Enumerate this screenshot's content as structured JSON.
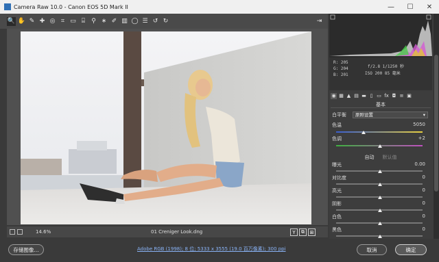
{
  "window": {
    "title": "Camera Raw 10.0 - Canon EOS 5D Mark II",
    "minimize": "—",
    "maximize": "☐",
    "close": "✕"
  },
  "toolbar": {
    "tools": [
      {
        "icon": "zoom-icon",
        "glyph": "🔍",
        "active": true
      },
      {
        "icon": "hand-icon",
        "glyph": "✋"
      },
      {
        "icon": "white-balance-icon",
        "glyph": "✎"
      },
      {
        "icon": "color-sampler-icon",
        "glyph": "✚"
      },
      {
        "icon": "targeted-adjust-icon",
        "glyph": "◎"
      },
      {
        "icon": "crop-icon",
        "glyph": "⌗"
      },
      {
        "icon": "straighten-icon",
        "glyph": "▭"
      },
      {
        "icon": "transform-icon",
        "glyph": "⌸"
      },
      {
        "icon": "spot-removal-icon",
        "glyph": "⚲"
      },
      {
        "icon": "red-eye-icon",
        "glyph": "∗"
      },
      {
        "icon": "adjustment-brush-icon",
        "glyph": "✐"
      },
      {
        "icon": "graduated-filter-icon",
        "glyph": "▥"
      },
      {
        "icon": "radial-filter-icon",
        "glyph": "◯"
      },
      {
        "icon": "preferences-icon",
        "glyph": "☰"
      },
      {
        "icon": "rotate-ccw-icon",
        "glyph": "↺"
      },
      {
        "icon": "rotate-cw-icon",
        "glyph": "↻"
      }
    ],
    "export_glyph": "⇥"
  },
  "canvas": {
    "zoom": "14.6%",
    "filename": "01 Creniger Look.dng",
    "view_buttons": [
      "Y",
      "⧉",
      "⊞"
    ]
  },
  "readout": {
    "r": "R:  205",
    "g": "G:  204",
    "b": "B:  201",
    "aperture": "f/2.8   1/1250 秒",
    "iso": "ISO 200   85 毫米"
  },
  "panel": {
    "icons": [
      {
        "icon": "basic-icon",
        "glyph": "◉",
        "active": true
      },
      {
        "icon": "tone-curve-icon",
        "glyph": "▦"
      },
      {
        "icon": "detail-icon",
        "glyph": "▲"
      },
      {
        "icon": "hsl-icon",
        "glyph": "▤"
      },
      {
        "icon": "split-toning-icon",
        "glyph": "▬"
      },
      {
        "icon": "lens-icon",
        "glyph": "▯"
      },
      {
        "icon": "transform-panel-icon",
        "glyph": "▭"
      },
      {
        "icon": "effects-icon",
        "glyph": "fx"
      },
      {
        "icon": "camera-calibration-icon",
        "glyph": "◘"
      },
      {
        "icon": "presets-icon",
        "glyph": "≡"
      },
      {
        "icon": "snapshots-icon",
        "glyph": "▣"
      }
    ],
    "title": "基本",
    "white_balance_label": "白平衡",
    "white_balance_value": "原照设置",
    "temp_label": "色温",
    "temp_value": "5050",
    "tint_label": "色调",
    "tint_value": "+2",
    "auto": "自动",
    "default": "默认值",
    "sliders": [
      {
        "label": "曝光",
        "value": "0.00"
      },
      {
        "label": "对比度",
        "value": "0"
      },
      {
        "label": "高光",
        "value": "0"
      },
      {
        "label": "阴影",
        "value": "0"
      },
      {
        "label": "白色",
        "value": "0"
      },
      {
        "label": "黑色",
        "value": "0"
      },
      {
        "label": "清晰度",
        "value": "0"
      }
    ]
  },
  "footer": {
    "save_label": "存储图像...",
    "workflow": "Adobe RGB (1998); 8 位; 5333 x 3555 (19.0 百万像素); 300 ppi",
    "cancel_label": "取消",
    "ok_label": "确定"
  },
  "colors": {
    "accent_link": "#8ab4f8",
    "panel_bg": "#3d3d3d",
    "toolbar_bg": "#4a4a4a"
  }
}
